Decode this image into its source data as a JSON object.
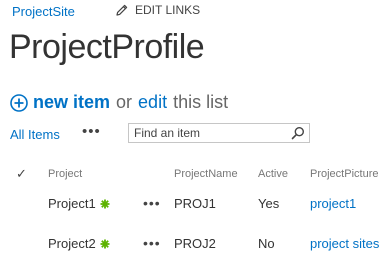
{
  "header": {
    "site_link": "ProjectSite",
    "edit_links_label": "EDIT LINKS",
    "page_title": "ProjectProfile"
  },
  "command_bar": {
    "new_item_label": "new item",
    "or_text": "or",
    "edit_label": "edit",
    "this_list_text": "this list"
  },
  "views": {
    "current_view": "All Items",
    "more_label": "•••"
  },
  "search": {
    "placeholder": "Find an item"
  },
  "table": {
    "check_glyph": "✓",
    "columns": [
      "Project",
      "ProjectName",
      "Active",
      "ProjectPicture"
    ],
    "rows": [
      {
        "project": "Project1",
        "menu": "•••",
        "project_name": "PROJ1",
        "active": "Yes",
        "picture_link": "project1"
      },
      {
        "project": "Project2",
        "menu": "•••",
        "project_name": "PROJ2",
        "active": "No",
        "picture_link": "project sites"
      }
    ]
  },
  "colors": {
    "accent": "#0072c6",
    "new_badge": "#5db300"
  },
  "icons": {
    "edit_links": "pencil-icon",
    "new_item": "plus-circle-icon",
    "search": "search-icon",
    "new_badge": "new-item-badge-icon"
  }
}
